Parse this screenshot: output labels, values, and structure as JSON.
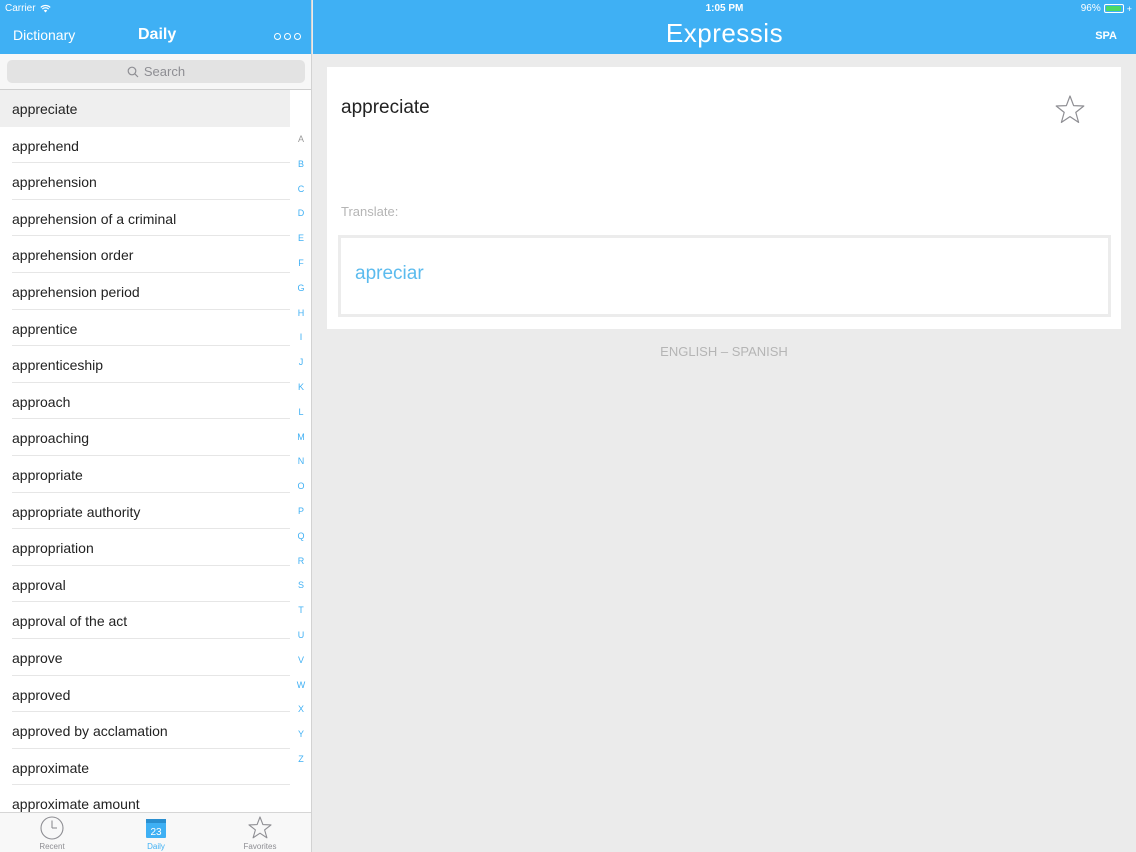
{
  "status": {
    "carrier": "Carrier",
    "time": "1:05 PM",
    "battery": "96%",
    "battery_level": 0.96
  },
  "left_header": {
    "dictionary_label": "Dictionary",
    "daily_label": "Daily"
  },
  "search": {
    "placeholder": "Search"
  },
  "word_list": [
    "appreciate",
    "apprehend",
    "apprehension",
    "apprehension of a criminal",
    "apprehension order",
    "apprehension period",
    "apprentice",
    "apprenticeship",
    "approach",
    "approaching",
    "appropriate",
    "appropriate authority",
    "appropriation",
    "approval",
    "approval of the act",
    "approve",
    "approved",
    "approved by acclamation",
    "approximate",
    "approximate amount"
  ],
  "selected_index": 0,
  "alphabet_index": [
    "A",
    "B",
    "C",
    "D",
    "E",
    "F",
    "G",
    "H",
    "I",
    "J",
    "K",
    "L",
    "M",
    "N",
    "O",
    "P",
    "Q",
    "R",
    "S",
    "T",
    "U",
    "V",
    "W",
    "X",
    "Y",
    "Z"
  ],
  "tabs": {
    "recent": {
      "label": "Recent",
      "icon": "clock-icon"
    },
    "daily": {
      "label": "Daily",
      "icon": "calendar-icon",
      "date": "23"
    },
    "favorites": {
      "label": "Favorites",
      "icon": "star-icon"
    }
  },
  "right_header": {
    "title": "Expressis",
    "language_button": "SPA"
  },
  "entry": {
    "word": "appreciate",
    "translate_label": "Translate:",
    "translation": "apreciar",
    "language_pair": "ENGLISH – SPANISH"
  },
  "colors": {
    "accent": "#3fb0f4",
    "translation_text": "#5bbbee",
    "battery_fill": "#4cd964"
  }
}
